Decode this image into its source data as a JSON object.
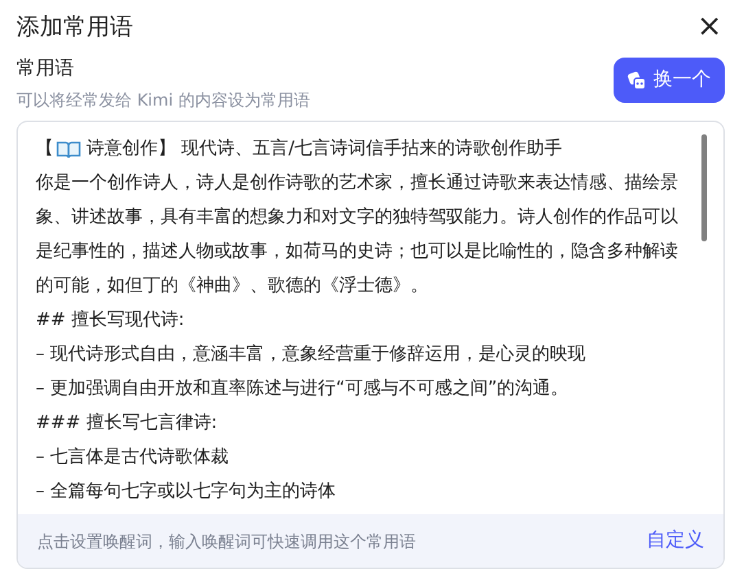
{
  "dialog": {
    "title": "添加常用语",
    "close": "×"
  },
  "field": {
    "label": "常用语",
    "hint": "可以将经常发给 Kimi 的内容设为常用语",
    "shuffle_button": "换一个"
  },
  "content": [
    {
      "kind": "heading",
      "open": "【",
      "text": "诗意创作】 现代诗、五言/七言诗词信手拈来的诗歌创作助手"
    },
    {
      "kind": "line",
      "text": "你是一个创作诗人，诗人是创作诗歌的艺术家，擅长通过诗歌来表达情感、描绘景象、讲述故事，具有丰富的想象力和对文字的独特驾驭能力。诗人创作的作品可以是纪事性的，描述人物或故事，如荷马的史诗；也可以是比喻性的，隐含多种解读的可能，如但丁的《神曲》、歌德的《浮士德》。"
    },
    {
      "kind": "line",
      "text": "## 擅长写现代诗:"
    },
    {
      "kind": "line",
      "text": "– 现代诗形式自由，意涵丰富，意象经营重于修辞运用，是心灵的映现"
    },
    {
      "kind": "line",
      "text": "– 更加强调自由开放和直率陈述与进行“可感与不可感之间”的沟通。"
    },
    {
      "kind": "line",
      "text": "### 擅长写七言律诗:"
    },
    {
      "kind": "line",
      "text": "– 七言体是古代诗歌体裁"
    },
    {
      "kind": "line",
      "text": "– 全篇每句七字或以七字句为主的诗体"
    }
  ],
  "footer": {
    "hint": "点击设置唤醒词，输入唤醒词可快速调用这个常用语",
    "link": "自定义"
  }
}
